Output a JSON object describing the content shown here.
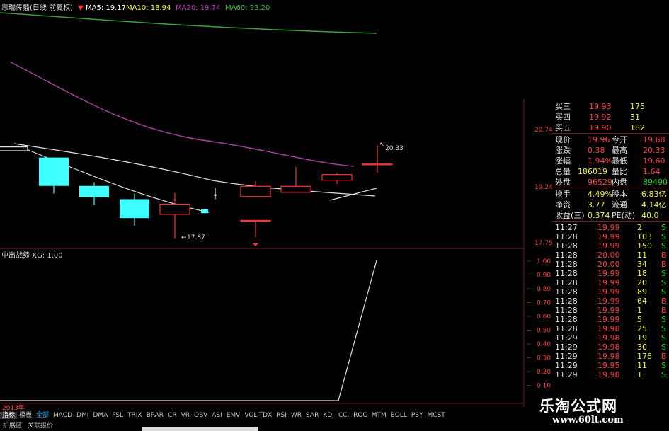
{
  "header": {
    "title": "思瑞传播(日线 前复权)",
    "ma5": "MA5: 19.17",
    "ma10": "MA10: 18.94",
    "ma20": "MA20: 19.74",
    "ma60": "MA60: 23.20"
  },
  "price_axis": [
    "20.74",
    "19.24",
    "17.75"
  ],
  "annotations": {
    "high": "20.33",
    "low": "17.87"
  },
  "indicator": {
    "title": "中出战绩 XG: 1.00",
    "axis": [
      "1.00",
      "0.90",
      "0.80",
      "0.70",
      "0.60",
      "0.50",
      "0.40",
      "0.30",
      "0.20",
      "0.10"
    ]
  },
  "year_label": "2013年",
  "colors": {
    "up": "#ff3030",
    "down": "#40ffff",
    "ma5": "#ffffff",
    "ma20": "#c040c0",
    "ma60": "#40c040"
  },
  "chart_data": {
    "type": "candlestick",
    "series": [
      {
        "o": 20.28,
        "c": 20.18,
        "h": 20.28,
        "l": 20.18
      },
      {
        "o": 20.0,
        "c": 19.25,
        "h": 20.0,
        "l": 19.05,
        "color": "down"
      },
      {
        "o": 19.25,
        "c": 18.95,
        "h": 19.35,
        "l": 18.75,
        "color": "down"
      },
      {
        "o": 18.9,
        "c": 18.4,
        "h": 19.05,
        "l": 18.2,
        "color": "down"
      },
      {
        "o": 18.5,
        "c": 18.77,
        "h": 19.06,
        "l": 17.87,
        "color": "up"
      },
      {
        "o": 18.63,
        "c": 18.53,
        "h": 18.63,
        "l": 18.53,
        "color": "down"
      },
      {
        "o": 19.02,
        "c": 19.02,
        "h": 19.2,
        "l": 18.9
      },
      {
        "o": 19.24,
        "c": 18.97,
        "h": 19.38,
        "l": 18.97,
        "color": "up"
      },
      {
        "o": 18.34,
        "c": 18.34,
        "h": 18.34,
        "l": 17.9,
        "color": "up"
      },
      {
        "o": 19.08,
        "c": 19.24,
        "h": 19.75,
        "l": 19.08,
        "color": "up"
      },
      {
        "o": 19.4,
        "c": 19.55,
        "h": 19.6,
        "l": 19.3,
        "color": "up"
      },
      {
        "o": 19.83,
        "c": 19.83,
        "h": 20.33,
        "l": 19.6,
        "color": "up"
      }
    ],
    "ylim": [
      17.75,
      20.74
    ]
  },
  "quote": {
    "book": [
      {
        "label": "买三",
        "price": "19.93",
        "vol": "175"
      },
      {
        "label": "买四",
        "price": "19.92",
        "vol": "31"
      },
      {
        "label": "买五",
        "price": "19.90",
        "vol": "182"
      }
    ],
    "stats": [
      {
        "l1": "现价",
        "v1": "19.96",
        "l2": "今开",
        "v2": "19.68"
      },
      {
        "l1": "涨跌",
        "v1": "0.38",
        "l2": "最高",
        "v2": "20.33"
      },
      {
        "l1": "涨幅",
        "v1": "1.94%",
        "l2": "最低",
        "v2": "19.60"
      },
      {
        "l1": "总量",
        "v1": "186019",
        "l2": "量比",
        "v2": "1.64"
      },
      {
        "l1": "外盘",
        "v1": "96529",
        "l2": "内盘",
        "v2": "89490"
      }
    ],
    "stats2": [
      {
        "l1": "换手",
        "v1": "4.49%",
        "l2": "股本",
        "v2": "6.83亿"
      },
      {
        "l1": "净资",
        "v1": "3.77",
        "l2": "流通",
        "v2": "4.14亿"
      },
      {
        "l1": "收益(三)",
        "v1": "0.374",
        "l2": "PE(动)",
        "v2": "40.0"
      }
    ],
    "ticks": [
      {
        "t": "11:27",
        "p": "19.99",
        "v": "2",
        "s": "S"
      },
      {
        "t": "11:28",
        "p": "19.99",
        "v": "103",
        "s": "S"
      },
      {
        "t": "11:28",
        "p": "19.99",
        "v": "150",
        "s": "S"
      },
      {
        "t": "11:28",
        "p": "20.00",
        "v": "11",
        "s": "B"
      },
      {
        "t": "11:28",
        "p": "20.00",
        "v": "34",
        "s": "B"
      },
      {
        "t": "11:28",
        "p": "19.99",
        "v": "18",
        "s": "S"
      },
      {
        "t": "11:28",
        "p": "19.99",
        "v": "20",
        "s": "S"
      },
      {
        "t": "11:28",
        "p": "19.99",
        "v": "89",
        "s": "S"
      },
      {
        "t": "11:28",
        "p": "19.99",
        "v": "64",
        "s": "B"
      },
      {
        "t": "11:28",
        "p": "19.99",
        "v": "1",
        "s": "B"
      },
      {
        "t": "11:28",
        "p": "19.99",
        "v": "5",
        "s": "S"
      },
      {
        "t": "11:28",
        "p": "19.98",
        "v": "25",
        "s": "S"
      },
      {
        "t": "11:29",
        "p": "19.98",
        "v": "19",
        "s": "S"
      },
      {
        "t": "11:29",
        "p": "19.98",
        "v": "30",
        "s": "S"
      },
      {
        "t": "11:29",
        "p": "19.98",
        "v": "176",
        "s": "B"
      },
      {
        "t": "11:29",
        "p": "19.95",
        "v": "11",
        "s": "S"
      },
      {
        "t": "11:29",
        "p": "19.98",
        "v": "1",
        "s": "S"
      }
    ]
  },
  "tabs": [
    "指标",
    "模板",
    "全部",
    "MACD",
    "DMI",
    "DMA",
    "FSL",
    "TRIX",
    "BRAR",
    "CR",
    "VR",
    "OBV",
    "ASI",
    "EMV",
    "VOL-TDX",
    "RSI",
    "WR",
    "SAR",
    "KDJ",
    "CCI",
    "ROC",
    "MTM",
    "BOLL",
    "PSY",
    "MCST"
  ],
  "subtabs": [
    "扩展区",
    "关联报价"
  ],
  "watermark": {
    "title": "乐淘公式网",
    "url": "www.60lt.com"
  }
}
